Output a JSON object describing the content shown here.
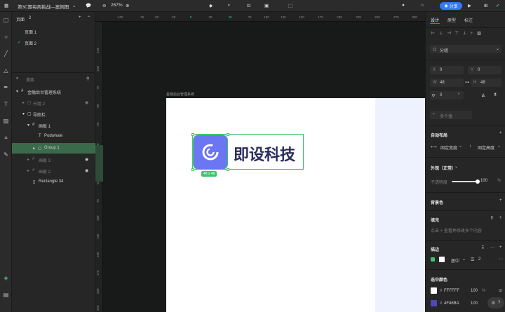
{
  "topbar": {
    "file_title": "第3C期每周挑战—案例图",
    "zoom": "267%",
    "share_label": "分享"
  },
  "layers": {
    "pages_header": "页面",
    "pages_count": "2",
    "pages": [
      {
        "label": "页面 1"
      },
      {
        "label": "页面 2",
        "active": true
      }
    ],
    "search_placeholder": "搜索",
    "items": [
      {
        "label": "金融后台管理系统",
        "kind": "frame"
      },
      {
        "label": "分组 2",
        "kind": "group",
        "dim": true
      },
      {
        "label": "导航栏",
        "kind": "group"
      },
      {
        "label": "画板 1",
        "kind": "frame"
      },
      {
        "label": "Podwhale",
        "kind": "text"
      },
      {
        "label": "Group 1",
        "kind": "group",
        "selected": true
      },
      {
        "label": "画板 3",
        "kind": "frame",
        "dim": true
      },
      {
        "label": "画板 2",
        "kind": "frame",
        "dim": true
      },
      {
        "label": "Rectangle 34",
        "kind": "rect"
      }
    ]
  },
  "canvas": {
    "ruler_top": [
      "-100",
      "-75",
      "-50",
      "-25",
      "0",
      "30",
      "48",
      "75",
      "100",
      "125",
      "150",
      "175",
      "200",
      "225",
      "250",
      "275",
      "300"
    ],
    "ruler_left": [
      "-125",
      "-100",
      "-75",
      "-50",
      "-25",
      "0",
      "25",
      "50",
      "75",
      "100",
      "125",
      "150",
      "175",
      "200",
      "225"
    ],
    "frame_label": "金融后台管理系统",
    "logo_text": "即设科技",
    "size_badge": "48 x 48"
  },
  "props": {
    "tabs": [
      "设计",
      "原型",
      "标注"
    ],
    "group_select": "分组",
    "x_label": "X",
    "x_value": "0",
    "y_label": "Y",
    "y_value": "0",
    "w_label": "W",
    "w_value": "48",
    "h_label": "H",
    "h_value": "48",
    "rotation_value": "0",
    "radius_placeholder": "多个值",
    "auto_layout_title": "自动布局",
    "fixed_width": "固定宽度",
    "fixed_height": "固定高度",
    "appearance_title": "外观（正常）",
    "opacity_label": "不透明度",
    "opacity_value": "100",
    "percent": "%",
    "background_title": "背景色",
    "fill_title": "填充",
    "fill_hint": "点击 + 查看并修改多个内容",
    "stroke_title": "描边",
    "stroke_align": "居中",
    "stroke_width": "2",
    "selection_colors_title": "选中颜色",
    "colors": [
      {
        "hex": "FFFFFF",
        "swatch": "#FFFFFF",
        "opacity": "100"
      },
      {
        "hex": "4F46BA",
        "swatch": "#4F46BA",
        "opacity": "100"
      }
    ]
  },
  "colors": {
    "accent": "#2f7bf6",
    "selection": "#3ec46d",
    "logo_tile": "#6b76f2",
    "logo_text": "#2a2e5c"
  }
}
